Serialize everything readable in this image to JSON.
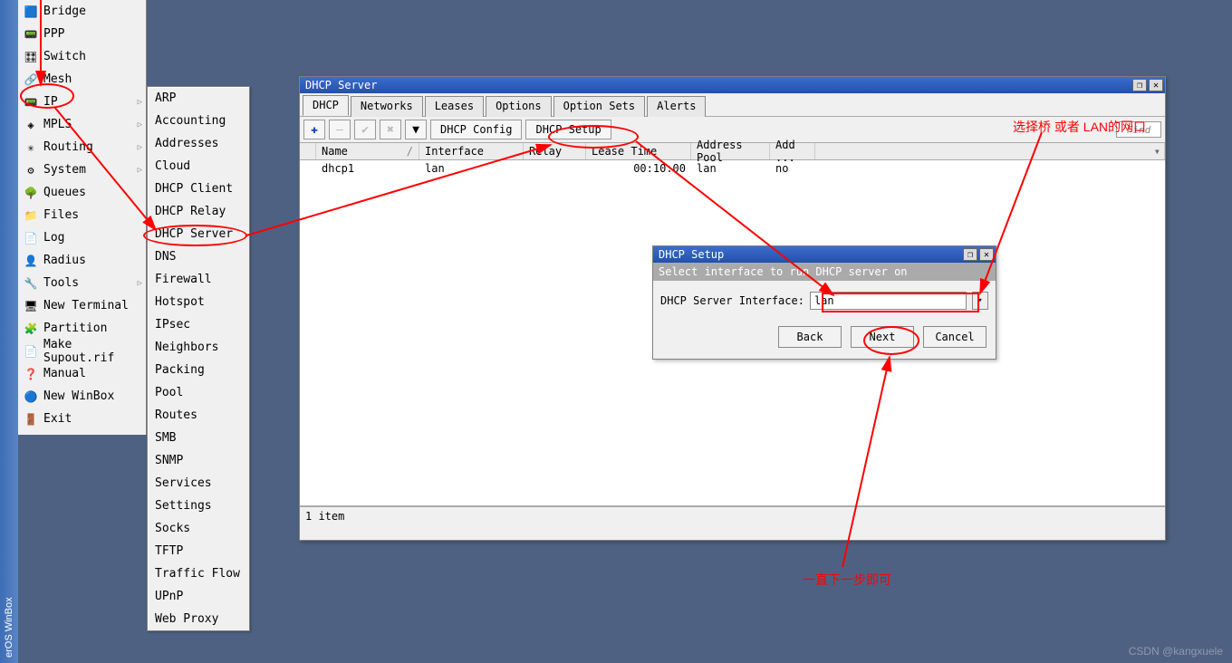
{
  "vstripe": "erOS WinBox",
  "main_menu": [
    {
      "icon": "🟦",
      "label": "Bridge",
      "arrow": false
    },
    {
      "icon": "📟",
      "label": "PPP",
      "arrow": false
    },
    {
      "icon": "🎛",
      "label": "Switch",
      "arrow": false
    },
    {
      "icon": "🔗",
      "label": "Mesh",
      "arrow": false
    },
    {
      "icon": "📟",
      "label": "IP",
      "arrow": true
    },
    {
      "icon": "◈",
      "label": "MPLS",
      "arrow": true
    },
    {
      "icon": "✳",
      "label": "Routing",
      "arrow": true
    },
    {
      "icon": "⚙",
      "label": "System",
      "arrow": true
    },
    {
      "icon": "🌳",
      "label": "Queues",
      "arrow": false
    },
    {
      "icon": "📁",
      "label": "Files",
      "arrow": false
    },
    {
      "icon": "📄",
      "label": "Log",
      "arrow": false
    },
    {
      "icon": "👤",
      "label": "Radius",
      "arrow": false
    },
    {
      "icon": "🔧",
      "label": "Tools",
      "arrow": true
    },
    {
      "icon": "🖥",
      "label": "New Terminal",
      "arrow": false
    },
    {
      "icon": "🧩",
      "label": "Partition",
      "arrow": false
    },
    {
      "icon": "📄",
      "label": "Make Supout.rif",
      "arrow": false
    },
    {
      "icon": "❓",
      "label": "Manual",
      "arrow": false
    },
    {
      "icon": "🔵",
      "label": "New WinBox",
      "arrow": false
    },
    {
      "icon": "🚪",
      "label": "Exit",
      "arrow": false
    }
  ],
  "sub_menu": [
    "ARP",
    "Accounting",
    "Addresses",
    "Cloud",
    "DHCP Client",
    "DHCP Relay",
    "DHCP Server",
    "DNS",
    "Firewall",
    "Hotspot",
    "IPsec",
    "Neighbors",
    "Packing",
    "Pool",
    "Routes",
    "SMB",
    "SNMP",
    "Services",
    "Settings",
    "Socks",
    "TFTP",
    "Traffic Flow",
    "UPnP",
    "Web Proxy"
  ],
  "dhcp": {
    "title": "DHCP Server",
    "tabs": [
      "DHCP",
      "Networks",
      "Leases",
      "Options",
      "Option Sets",
      "Alerts"
    ],
    "active_tab": 0,
    "toolbar": {
      "dhcp_config": "DHCP Config",
      "dhcp_setup": "DHCP Setup",
      "find": "Find"
    },
    "columns": [
      "",
      "Name",
      "Interface",
      "Relay",
      "Lease Time",
      "Address Pool",
      "Add ..."
    ],
    "rows": [
      {
        "name": "dhcp1",
        "iface": "lan",
        "relay": "",
        "lease": "00:10:00",
        "pool": "lan",
        "add": "no"
      }
    ],
    "status": "1 item"
  },
  "setup": {
    "title": "DHCP Setup",
    "info": "Select interface to run DHCP server on",
    "label": "DHCP Server Interface:",
    "value": "lan",
    "back": "Back",
    "next": "Next",
    "cancel": "Cancel"
  },
  "annotations": {
    "text1": "选择桥 或者 LAN的网口",
    "text2": "一直下一步即可"
  },
  "watermark": "CSDN @kangxuele"
}
